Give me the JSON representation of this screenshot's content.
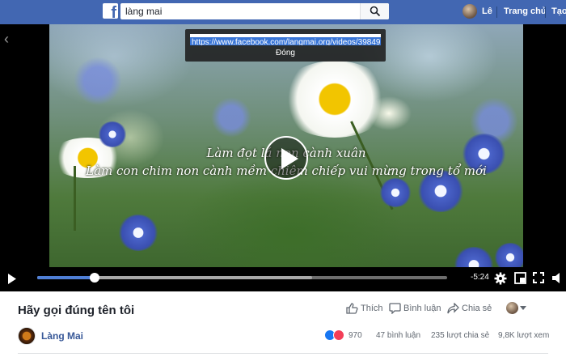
{
  "nav": {
    "logo": "f",
    "search_value": "làng mai",
    "user_name": "Lê",
    "home_label": "Trang chủ",
    "create_label": "Tạo"
  },
  "video": {
    "share_url": "https://www.facebook.com/langmai.org/videos/398497",
    "close_label": "Đóng",
    "lyric_line_1": "Làm đọt lá  non cành xuân",
    "lyric_line_2": "Làm con chim non cành mềm chiêm chiếp vui mừng trong tổ mới",
    "time_remaining": "-5:24",
    "progress_fraction": 0.14,
    "buffer_fraction": 0.67
  },
  "info": {
    "title": "Hãy gọi đúng tên tôi",
    "like_label": "Thích",
    "comment_label": "Bình luận",
    "share_label": "Chia sẻ",
    "page_name": "Làng Mai",
    "reaction_count": "970",
    "comments_count": "47 bình luận",
    "shares_count": "235 lượt chia sẻ",
    "views_count": "9,8K lượt xem"
  },
  "colors": {
    "nav_blue": "#4267b2",
    "progress_blue": "#4f7fd6",
    "link_blue": "#385898"
  },
  "icons": [
    "facebook-logo",
    "search-icon",
    "play-icon",
    "settings-icon",
    "miniplayer-icon",
    "fullscreen-icon",
    "volume-icon",
    "like-icon",
    "comment-icon",
    "share-icon",
    "chevron-left-icon"
  ]
}
